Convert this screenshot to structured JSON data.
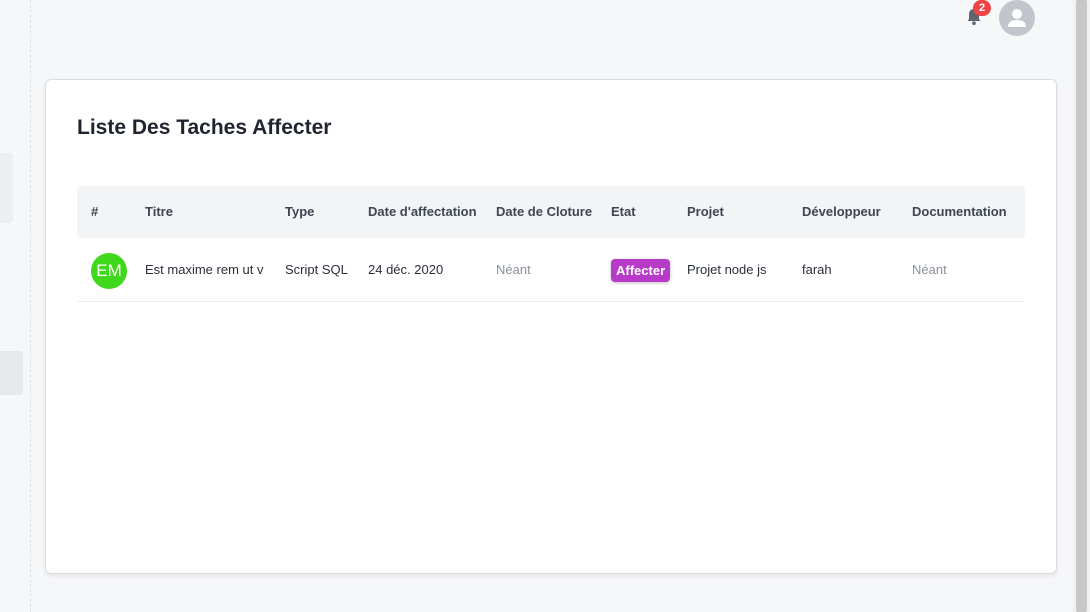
{
  "header": {
    "notification_count": "2",
    "bell_icon": "bell-icon",
    "avatar_icon": "user-icon"
  },
  "card": {
    "title": "Liste Des Taches Affecter"
  },
  "table": {
    "columns": [
      "#",
      "Titre",
      "Type",
      "Date d'affectation",
      "Date de Cloture",
      "Etat",
      "Projet",
      "Développeur",
      "Documentation"
    ],
    "rows": [
      {
        "initials": "EM",
        "titre": "Est maxime rem ut v",
        "type": "Script SQL",
        "date_affectation": "24 déc. 2020",
        "date_cloture": "Néant",
        "etat": "Affecter",
        "projet": "Projet node js",
        "developpeur": "farah",
        "documentation": "Néant"
      }
    ]
  },
  "colors": {
    "avatar_green": "#40d81b",
    "status_purple": "#b73ac8",
    "badge_red": "#ef4444"
  }
}
